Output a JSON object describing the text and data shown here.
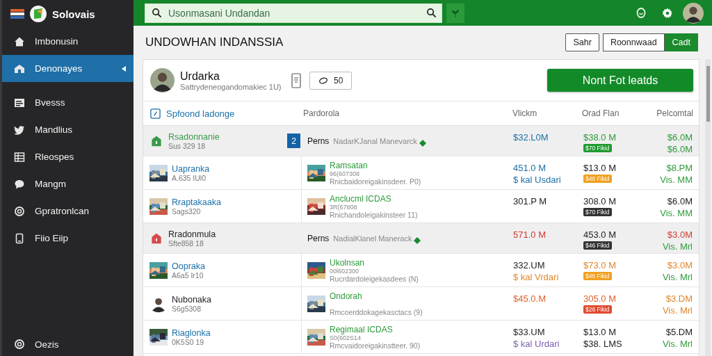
{
  "app": {
    "name": "Solovais"
  },
  "sidebar": {
    "items": [
      {
        "label": "Imbonusin",
        "selected": false
      },
      {
        "label": "Denonayes",
        "selected": true
      },
      {
        "label": "Bvesss",
        "selected": false
      },
      {
        "label": "Mandlius",
        "selected": false
      },
      {
        "label": "Rleospes",
        "selected": false
      },
      {
        "label": "Mangm",
        "selected": false
      },
      {
        "label": "Gpratronlcan",
        "selected": false
      },
      {
        "label": "Fiio Eiip",
        "selected": false
      }
    ],
    "footer": {
      "label": "Oezis"
    }
  },
  "topbar": {
    "search": {
      "placeholder": "Usonmasani Undandan"
    }
  },
  "page": {
    "title": "UNDOWHAN INDANSSIA",
    "actions": [
      {
        "label": "Sahr"
      }
    ],
    "toggle": [
      {
        "label": "Roonnwaad",
        "selected": false
      },
      {
        "label": "Cadt",
        "selected": true
      }
    ]
  },
  "profile": {
    "name": "Urdarka",
    "subtitle": "Sattrydeneogandomakiec 1U)",
    "count": "50",
    "action": "Nont Fot leatds"
  },
  "table": {
    "columns": [
      "Spfoond ladonge",
      "Pardorola",
      "Vlickm",
      "Orad Flan",
      "Pelcomtal"
    ],
    "rows": [
      {
        "kind": "group",
        "color": "#3a9a48",
        "name": {
          "text": "Rsadonnanie",
          "color": "#3a9a48"
        },
        "sub": "Sus 329 18",
        "badge": "2",
        "lead": "Perns",
        "detail": "NadarKJanal Manevarck",
        "c3": [
          {
            "kind": "text",
            "text": "$32.L0M",
            "color": "#1a6fa8"
          }
        ],
        "c4": [
          {
            "kind": "text",
            "text": "$38.0 M",
            "color": "#2c9b3a"
          },
          {
            "kind": "tag",
            "text": "$70 Fikid",
            "color": "#1f9a2f"
          }
        ],
        "c5": [
          {
            "kind": "text",
            "text": "$6.0M",
            "color": "#2c9b3a"
          },
          {
            "kind": "text",
            "text": "$6.0M",
            "color": "#2c9b3a"
          }
        ]
      },
      {
        "kind": "item",
        "thumb": {
          "kind": "picture"
        },
        "name": {
          "text": "Uapranka",
          "color": "#1a6fa8"
        },
        "sub": "A.635 IUl0",
        "partner": "Ramsatan",
        "code": "96(607308",
        "note": "Rnicbaidoreigakinsdeer. P0)",
        "c3": [
          {
            "kind": "text",
            "text": "451.0 M",
            "color": "#1a6fa8"
          },
          {
            "kind": "text",
            "text": "$ kal Usdari",
            "color": "#1a6fa8"
          }
        ],
        "c4": [
          {
            "kind": "text",
            "text": "$13.0 M",
            "color": "#222222"
          },
          {
            "kind": "tag",
            "text": "$46 Fikid",
            "color": "#f0a020"
          }
        ],
        "c5": [
          {
            "kind": "text",
            "text": "$8.PM",
            "color": "#2c9b3a"
          },
          {
            "kind": "text",
            "text": "Vis. MM",
            "color": "#2c9b3a"
          }
        ]
      },
      {
        "kind": "item",
        "thumb": {
          "kind": "picture"
        },
        "name": {
          "text": "Rraptakaaka",
          "color": "#1a6fa8"
        },
        "sub": "Sags320",
        "partner": "Anclucml ICDAS",
        "code": "3R(67808",
        "note": "Rnichandoleigakinsteer 11)",
        "c3": [
          {
            "kind": "text",
            "text": "301.P M",
            "color": "#222222"
          }
        ],
        "c4": [
          {
            "kind": "text",
            "text": "308.0 M",
            "color": "#222222"
          },
          {
            "kind": "tag",
            "text": "$70 Fikid",
            "color": "#333333"
          }
        ],
        "c5": [
          {
            "kind": "text",
            "text": "$6.0M",
            "color": "#222222"
          },
          {
            "kind": "text",
            "text": "Vis. MM",
            "color": "#2c9b3a"
          }
        ]
      },
      {
        "kind": "group",
        "color": "#d84a4a",
        "name": {
          "text": "Rradonmula",
          "color": "#222222"
        },
        "sub": "Sfte858 18",
        "lead": "Perns",
        "detail": "NadialKlanel Manerack",
        "c3": [
          {
            "kind": "text",
            "text": "571.0 M",
            "color": "#d33a2f"
          }
        ],
        "c4": [
          {
            "kind": "text",
            "text": "453.0 M",
            "color": "#222222"
          },
          {
            "kind": "tag",
            "text": "$46 Fikid",
            "color": "#333333"
          }
        ],
        "c5": [
          {
            "kind": "text",
            "text": "$3.0M",
            "color": "#d33a2f"
          },
          {
            "kind": "text",
            "text": "Vis. Mrl",
            "color": "#2c9b3a"
          }
        ]
      },
      {
        "kind": "item",
        "thumb": {
          "kind": "picture"
        },
        "name": {
          "text": "Oopraka",
          "color": "#1a6fa8"
        },
        "sub": "A6a5 Ir10",
        "partner": "Ukolnsan",
        "code": "00l602300",
        "note": "Rucrdardoleigekasdees (N)",
        "c3": [
          {
            "kind": "text",
            "text": "332.UM",
            "color": "#222222"
          },
          {
            "kind": "text",
            "text": "$ kal Vrdari",
            "color": "#e0862a"
          }
        ],
        "c4": [
          {
            "kind": "text",
            "text": "$73.0 M",
            "color": "#e0862a"
          },
          {
            "kind": "tag",
            "text": "$46 Fikid",
            "color": "#f0a020"
          }
        ],
        "c5": [
          {
            "kind": "text",
            "text": "$3.0M",
            "color": "#e0862a"
          },
          {
            "kind": "text",
            "text": "Vis. Mrl",
            "color": "#2c9b3a"
          }
        ]
      },
      {
        "kind": "item",
        "thumb": {
          "kind": "avatar"
        },
        "name": {
          "text": "Nubonaka",
          "color": "#222222"
        },
        "sub": "S6g5308",
        "partner": "Ondorah",
        "note": "Rmcoerddokagekasctacs (9)",
        "c3": [
          {
            "kind": "text",
            "text": "$45.0.M",
            "color": "#e0622a"
          }
        ],
        "c4": [
          {
            "kind": "text",
            "text": "305.0 M",
            "color": "#e0622a"
          },
          {
            "kind": "tag",
            "text": "$26 Fikid",
            "color": "#e04a30"
          }
        ],
        "c5": [
          {
            "kind": "text",
            "text": "$3.DM",
            "color": "#e0862a"
          },
          {
            "kind": "text",
            "text": "Vis. Mrl",
            "color": "#e0862a"
          }
        ]
      },
      {
        "kind": "item",
        "thumb": {
          "kind": "picture"
        },
        "name": {
          "text": "Riaglonka",
          "color": "#1a6fa8"
        },
        "sub": "0K5S0 19",
        "partner": "Regimaal ICDAS",
        "code": "S0(602S14",
        "note": "Rmcvaidoreigakinstteer. 90)",
        "c3": [
          {
            "kind": "text",
            "text": "$33.UM",
            "color": "#222222"
          },
          {
            "kind": "text",
            "text": "$ kal Urdari",
            "color": "#7a5fb0"
          }
        ],
        "c4": [
          {
            "kind": "text",
            "text": "$13.0 M",
            "color": "#222222"
          },
          {
            "kind": "text",
            "text": "$38. LMS",
            "color": "#222222"
          }
        ],
        "c5": [
          {
            "kind": "text",
            "text": "$5.DM",
            "color": "#222222"
          },
          {
            "kind": "text",
            "text": "Vis. Mrl",
            "color": "#2c9b3a"
          }
        ]
      }
    ]
  }
}
